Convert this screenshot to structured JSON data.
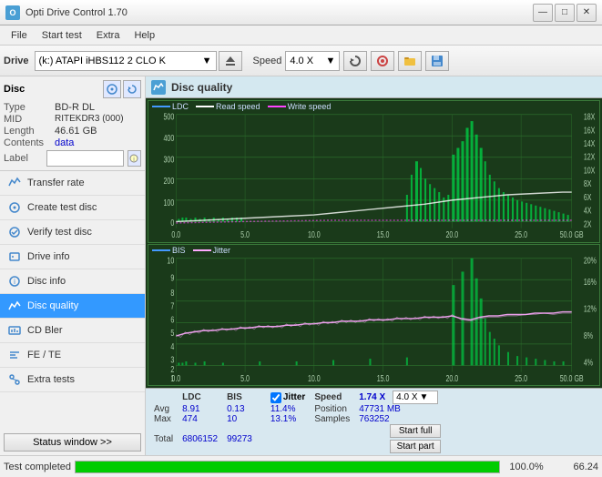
{
  "titleBar": {
    "appName": "Opti Drive Control 1.70",
    "icon": "O",
    "controls": {
      "minimize": "—",
      "maximize": "□",
      "close": "✕"
    }
  },
  "menuBar": {
    "items": [
      "File",
      "Start test",
      "Extra",
      "Help"
    ]
  },
  "toolbar": {
    "driveLabel": "Drive",
    "driveValue": "(k:)  ATAPI iHBS112  2 CLO K",
    "speedLabel": "Speed",
    "speedValue": "4.0 X"
  },
  "sidebar": {
    "discTitle": "Disc",
    "fields": [
      {
        "label": "Type",
        "value": "BD-R DL"
      },
      {
        "label": "MID",
        "value": "RITEKDR3 (000)"
      },
      {
        "label": "Length",
        "value": "46.61 GB"
      },
      {
        "label": "Contents",
        "value": "data"
      },
      {
        "label": "Label",
        "value": ""
      }
    ],
    "buttons": [
      {
        "id": "transfer-rate",
        "label": "Transfer rate"
      },
      {
        "id": "create-test-disc",
        "label": "Create test disc"
      },
      {
        "id": "verify-test-disc",
        "label": "Verify test disc"
      },
      {
        "id": "drive-info",
        "label": "Drive info"
      },
      {
        "id": "disc-info",
        "label": "Disc info"
      },
      {
        "id": "disc-quality",
        "label": "Disc quality",
        "active": true
      },
      {
        "id": "cd-bler",
        "label": "CD Bler"
      },
      {
        "id": "fe-te",
        "label": "FE / TE"
      },
      {
        "id": "extra-tests",
        "label": "Extra tests"
      }
    ],
    "statusWindowBtn": "Status window >>"
  },
  "discQuality": {
    "title": "Disc quality",
    "upperChart": {
      "legend": [
        "LDC",
        "Read speed",
        "Write speed"
      ],
      "yMax": 500,
      "xMax": 50,
      "rightYLabels": [
        "18X",
        "16X",
        "14X",
        "12X",
        "10X",
        "8X",
        "6X",
        "4X",
        "2X"
      ]
    },
    "lowerChart": {
      "legend": [
        "BIS",
        "Jitter"
      ],
      "yMax": 10,
      "xMax": 50,
      "rightYLabels": [
        "20%",
        "16%",
        "12%",
        "8%",
        "4%"
      ]
    },
    "stats": {
      "columns": [
        "LDC",
        "BIS",
        "",
        "Jitter",
        "Speed",
        "1.74 X",
        "4.0 X"
      ],
      "rows": [
        {
          "label": "Avg",
          "ldc": "8.91",
          "bis": "0.13",
          "jitter": "11.4%"
        },
        {
          "label": "Max",
          "ldc": "474",
          "bis": "10",
          "jitter": "13.1%",
          "position": "47731 MB"
        },
        {
          "label": "Total",
          "ldc": "6806152",
          "bis": "99273",
          "jitter": "",
          "samples": "763252"
        }
      ],
      "jitterChecked": true,
      "speedLabel": "Speed",
      "speedVal": "1.74 X",
      "speedDropdown": "4.0 X",
      "positionLabel": "Position",
      "positionVal": "47731 MB",
      "samplesLabel": "Samples",
      "samplesVal": "763252",
      "startFull": "Start full",
      "startPart": "Start part"
    }
  },
  "progressBar": {
    "statusText": "Test completed",
    "percent": 100,
    "percentDisplay": "100.0%",
    "value": "66.24"
  }
}
